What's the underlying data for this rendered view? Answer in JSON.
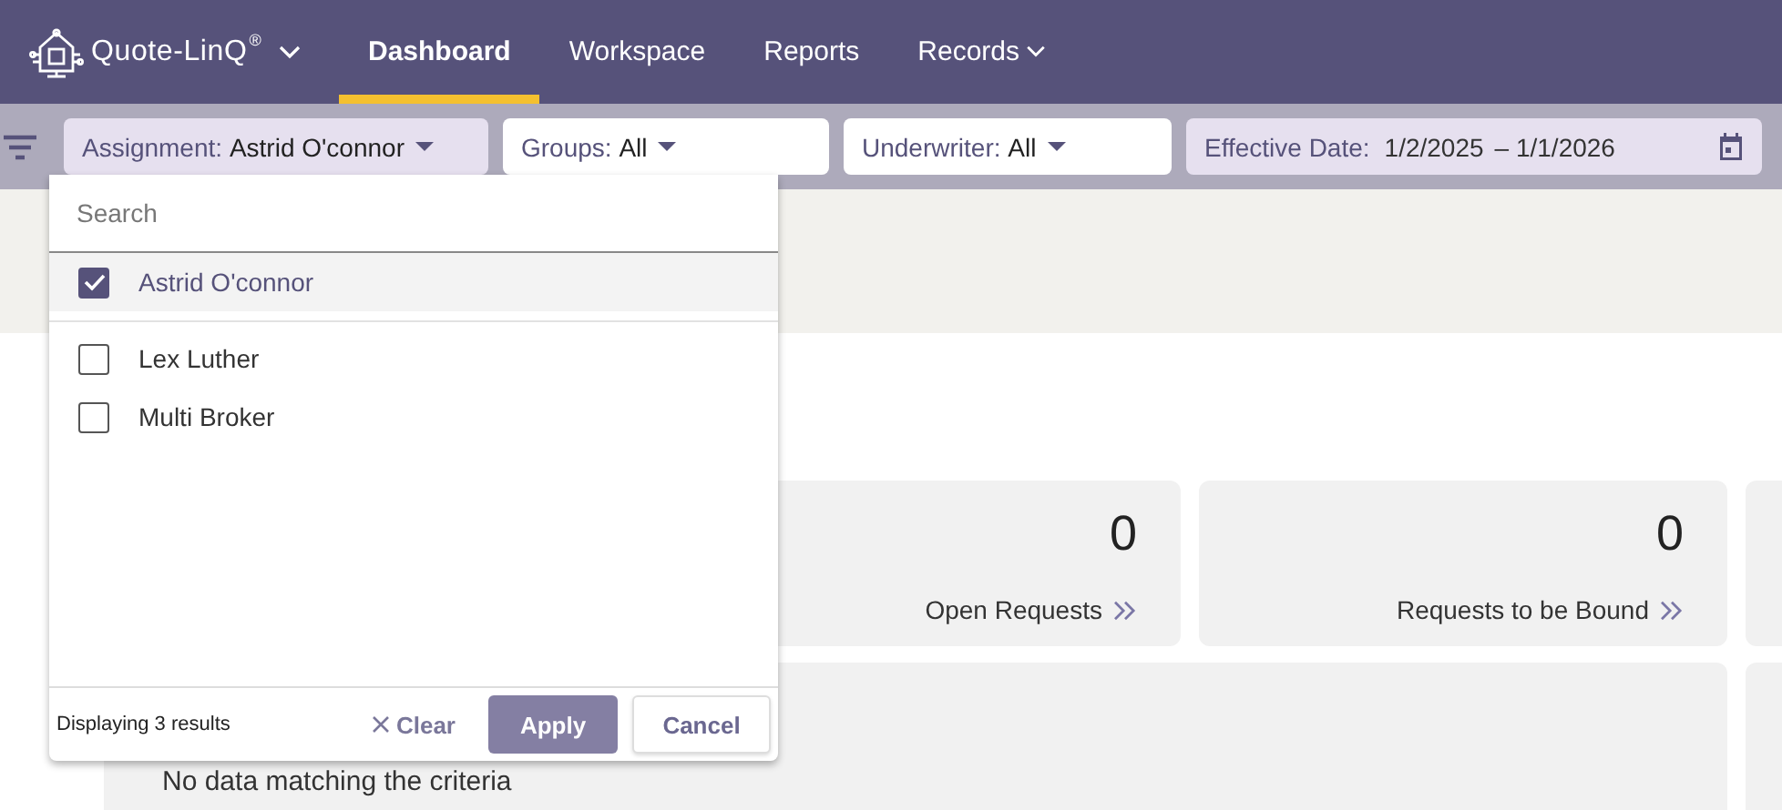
{
  "app": {
    "name": "Quote-LinQ",
    "mark": "®"
  },
  "nav": [
    {
      "label": "Dashboard",
      "selected": true,
      "has_menu": false
    },
    {
      "label": "Workspace",
      "selected": false,
      "has_menu": false
    },
    {
      "label": "Reports",
      "selected": false,
      "has_menu": false
    },
    {
      "label": "Records",
      "selected": false,
      "has_menu": true
    }
  ],
  "filters": [
    {
      "label": "Assignment:",
      "value": "Astrid O'connor",
      "open": true
    },
    {
      "label": "Groups:",
      "value": "All",
      "open": false
    },
    {
      "label": "Underwriter:",
      "value": "All",
      "open": false
    }
  ],
  "date_filter": {
    "label": "Effective Date:",
    "from": "1/2/2025",
    "separator": "–",
    "to": "1/1/2026"
  },
  "dropdown": {
    "placeholder": "Search",
    "options": [
      {
        "label": "Astrid O'connor",
        "checked": true
      },
      {
        "label": "Lex Luther",
        "checked": false
      },
      {
        "label": "Multi Broker",
        "checked": false
      }
    ],
    "result_count": "Displaying 3 results",
    "buttons": [
      {
        "kind": "clear",
        "label": "Clear"
      },
      {
        "kind": "primary",
        "label": "Apply"
      },
      {
        "kind": "secondary",
        "label": "Cancel"
      }
    ]
  },
  "cards": [
    {
      "value": "0",
      "label": "Open Requests"
    },
    {
      "value": "0",
      "label": "Requests to be Bound"
    }
  ],
  "empty_message": "No data matching the criteria"
}
